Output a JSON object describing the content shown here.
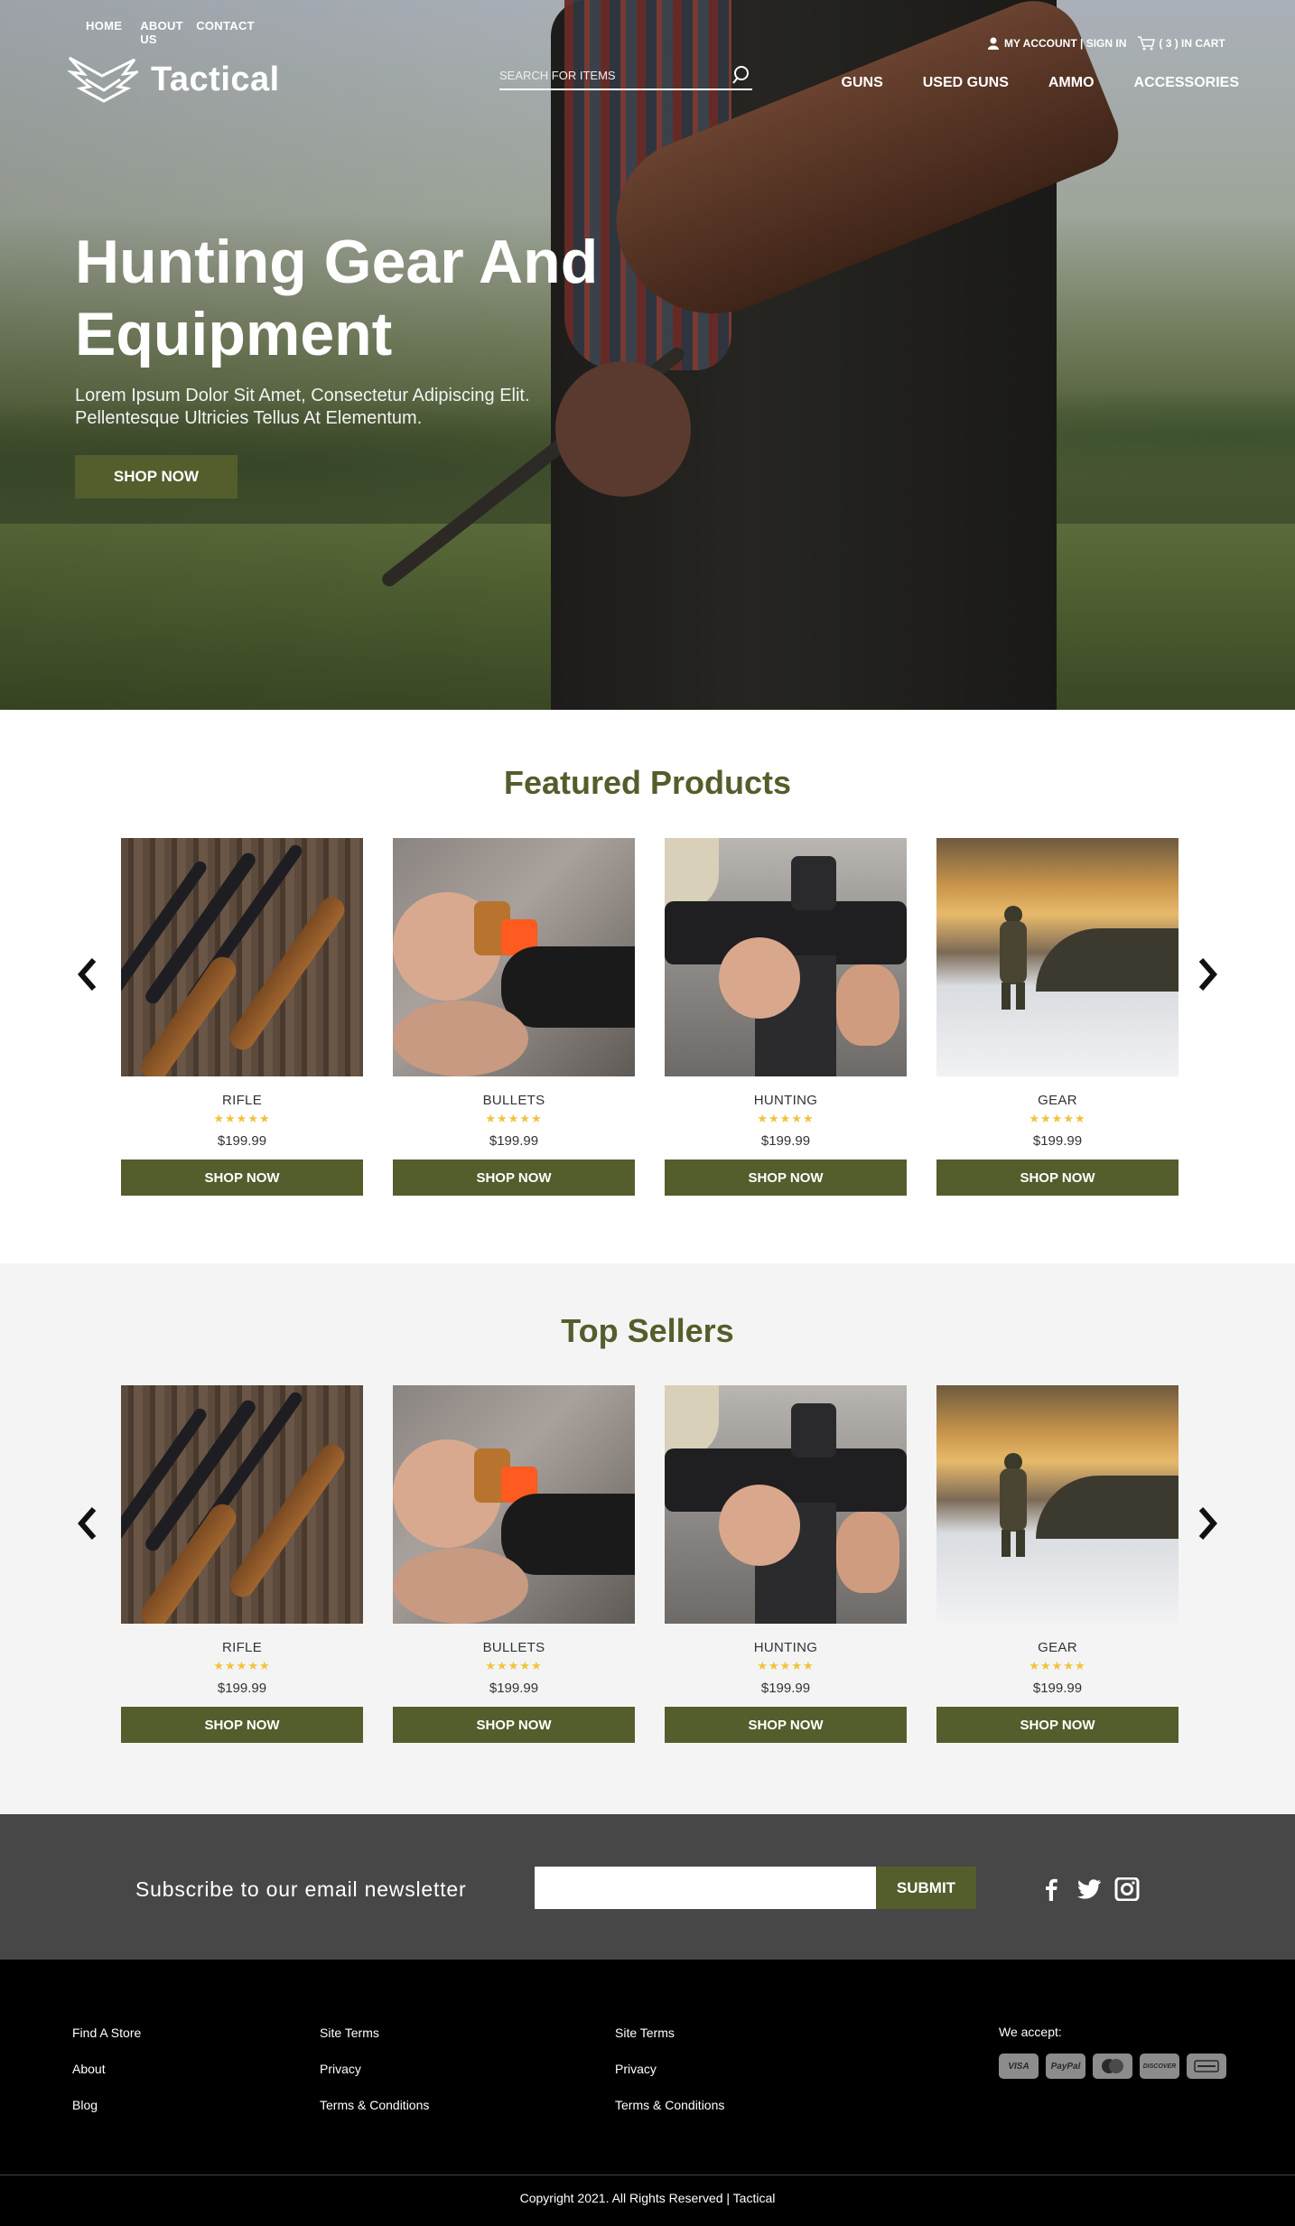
{
  "topnav": {
    "home": "HOME",
    "about": "ABOUT US",
    "contact": "CONTACT"
  },
  "brand": {
    "name": "Tactical"
  },
  "search": {
    "placeholder": "SEARCH FOR ITEMS"
  },
  "account": {
    "label": "MY ACCOUNT | SIGN IN",
    "cart": "( 3 ) IN CART"
  },
  "mainnav": [
    "GUNS",
    "USED GUNS",
    "AMMO",
    "ACCESSORIES"
  ],
  "hero": {
    "title": "Hunting Gear And Equipment",
    "subtitle": "Lorem Ipsum Dolor Sit Amet, Consectetur Adipiscing Elit. Pellentesque Ultricies Tellus At Elementum.",
    "button": "SHOP NOW"
  },
  "featured": {
    "title": "Featured Products",
    "products": [
      {
        "name": "RIFLE",
        "stars": "★★★★★",
        "price": "$199.99",
        "button": "SHOP NOW"
      },
      {
        "name": "BULLETS",
        "stars": "★★★★★",
        "price": "$199.99",
        "button": "SHOP NOW"
      },
      {
        "name": "HUNTING",
        "stars": "★★★★★",
        "price": "$199.99",
        "button": "SHOP NOW"
      },
      {
        "name": "GEAR",
        "stars": "★★★★★",
        "price": "$199.99",
        "button": "SHOP NOW"
      }
    ]
  },
  "topsellers": {
    "title": "Top Sellers",
    "products": [
      {
        "name": "RIFLE",
        "stars": "★★★★★",
        "price": "$199.99",
        "button": "SHOP NOW"
      },
      {
        "name": "BULLETS",
        "stars": "★★★★★",
        "price": "$199.99",
        "button": "SHOP NOW"
      },
      {
        "name": "HUNTING",
        "stars": "★★★★★",
        "price": "$199.99",
        "button": "SHOP NOW"
      },
      {
        "name": "GEAR",
        "stars": "★★★★★",
        "price": "$199.99",
        "button": "SHOP NOW"
      }
    ]
  },
  "newsletter": {
    "label": "Subscribe to our email newsletter",
    "button": "SUBMIT"
  },
  "social": [
    "facebook-icon",
    "twitter-icon",
    "instagram-icon"
  ],
  "footer": {
    "col1": [
      "Find A Store",
      "About",
      "Blog"
    ],
    "col2": [
      "Site Terms",
      "Privacy",
      "Terms & Conditions"
    ],
    "col3": [
      "Site Terms",
      "Privacy",
      "Terms & Conditions"
    ],
    "accept": "We accept:",
    "payments": [
      "VISA",
      "PayPal",
      "",
      "DISCOVER",
      ""
    ],
    "copyright": "Copyright 2021. All Rights Reserved | Tactical"
  },
  "colors": {
    "accent": "#535e2c",
    "newsletter_bg": "#474747",
    "footer_bg": "#000000",
    "star": "#f2c23a"
  }
}
